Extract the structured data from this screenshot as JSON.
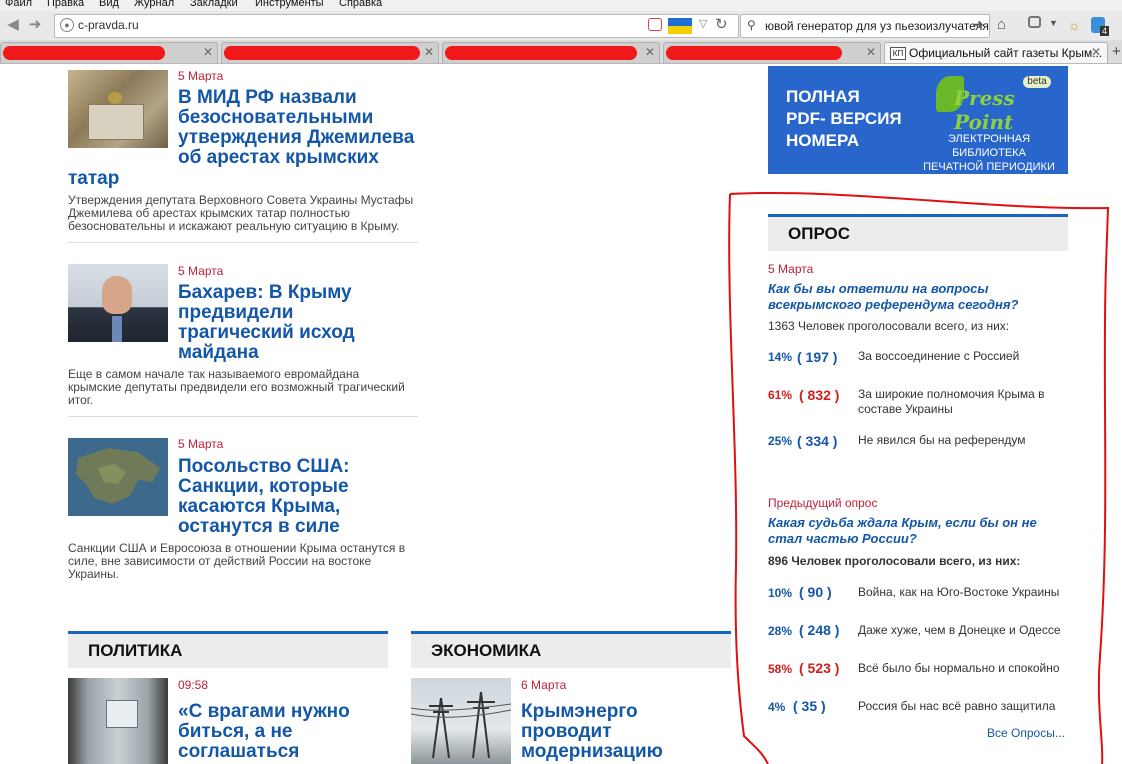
{
  "browser": {
    "menu": [
      "Файл",
      "Правка",
      "Вид",
      "Журнал",
      "Закладки",
      "Инструменты",
      "Справка"
    ],
    "url": "c-pravda.ru",
    "search_text": "ювой генератор для уз пьезоизлучателя",
    "active_tab_favicon": "КП",
    "active_tab_title": "Официальный сайт газеты Крым...",
    "badge": "4"
  },
  "articles": [
    {
      "date": "5 Марта",
      "title_lines": [
        "В МИД РФ назвали",
        "безосновательными",
        "утверждения Джемилева",
        "об арестах крымских"
      ],
      "title_tail": "татар",
      "lede": [
        "Утверждения депутата Верховного Совета Украины Мустафы",
        "Джемилева об арестах крымских татар полностью",
        "безосновательны и искажают реальную ситуацию в Крыму."
      ]
    },
    {
      "date": "5 Марта",
      "title_lines": [
        "Бахарев: В Крыму",
        "предвидели",
        "трагический исход",
        "майдана"
      ],
      "lede": [
        "Еще в самом начале так называемого евромайдана",
        "крымские депутаты предвидели его возможный трагический",
        "итог."
      ]
    },
    {
      "date": "5 Марта",
      "title_lines": [
        "Посольство США:",
        "Санкции, которые",
        "касаются Крыма,",
        "останутся в силе"
      ],
      "lede": [
        "Санкции США и Евросоюза в отношении Крыма останутся в",
        "силе, вне зависимости от действий России на востоке",
        "Украины."
      ]
    }
  ],
  "sections": [
    {
      "title": "ПОЛИТИКА",
      "date": "09:58",
      "title_lines": [
        "«С врагами нужно",
        "биться, а не",
        "соглашаться"
      ]
    },
    {
      "title": "ЭКОНОМИКА",
      "date": "6 Марта",
      "title_lines": [
        "Крымэнерго",
        "проводит",
        "модернизацию"
      ]
    }
  ],
  "banner": {
    "left": [
      "ПОЛНАЯ",
      "PDF- ВЕРСИЯ",
      "НОМЕРА"
    ],
    "logo": "Press Point",
    "beta": "beta",
    "sub": [
      "ЭЛЕКТРОННАЯ БИБЛИОТЕКА",
      "ПЕЧАТНОЙ ПЕРИОДИКИ"
    ]
  },
  "poll": {
    "heading": "ОПРОС",
    "date": "5 Марта",
    "question": [
      "Как бы вы ответили на вопросы",
      "всекрымского референдума сегодня?"
    ],
    "total": "1363 Человек проголосовали всего, из них:",
    "answers": [
      {
        "pct": "14%",
        "count": "( 197 )",
        "text": [
          "За воссоединение с Россией"
        ],
        "color": "#1457a6"
      },
      {
        "pct": "61%",
        "count": "( 832 )",
        "text": [
          "За широкие полномочия Крыма в",
          "составе Украины"
        ],
        "color": "#d21d1d"
      },
      {
        "pct": "25%",
        "count": "( 334 )",
        "text": [
          "Не явился бы на референдум"
        ],
        "color": "#1457a6"
      }
    ],
    "prev_label": "Предыдущий опрос",
    "prev_question": [
      "Какая судьба ждала Крым, если бы он не",
      "стал частью России?"
    ],
    "prev_total": "896 Человек проголосовали всего, из них:",
    "prev_answers": [
      {
        "pct": "10%",
        "count": "( 90 )",
        "text": "Война, как на Юго-Востоке Украины",
        "color": "#1457a6"
      },
      {
        "pct": "28%",
        "count": "( 248 )",
        "text": "Даже хуже, чем в Донецке и Одессе",
        "color": "#1457a6"
      },
      {
        "pct": "58%",
        "count": "( 523 )",
        "text": "Всё было бы нормально и спокойно",
        "color": "#d21d1d"
      },
      {
        "pct": "4%",
        "count": "( 35 )",
        "text": "Россия бы нас всё равно защитила",
        "color": "#1457a6"
      }
    ],
    "all_link": "Все Опросы..."
  }
}
